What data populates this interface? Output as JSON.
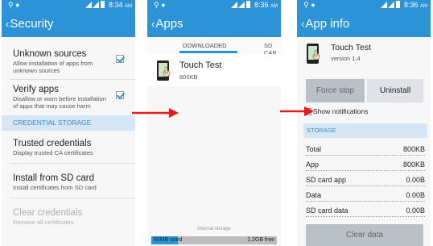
{
  "colors": {
    "accent": "#2d93d7",
    "header_bg": "#d6e6f4",
    "arrow": "#e8191c"
  },
  "status_bars": [
    {
      "time": "8:34",
      "ampm": "AM"
    },
    {
      "time": "8:36",
      "ampm": "AM"
    },
    {
      "time": "8:36",
      "ampm": "AM"
    }
  ],
  "security": {
    "title": "Security",
    "items": [
      {
        "title": "Unknown sources",
        "subtitle": "Allow installation of apps from unknown sources",
        "checked": true
      },
      {
        "title": "Verify apps",
        "subtitle": "Disallow or warn before installation of apps that may cause harm",
        "checked": true
      }
    ],
    "section_header": "CREDENTIAL STORAGE",
    "cred_items": [
      {
        "title": "Trusted credentials",
        "subtitle": "Display trusted CA certificates"
      },
      {
        "title": "Install from SD card",
        "subtitle": "Install certificates from SD card"
      },
      {
        "title": "Clear credentials",
        "subtitle": "Remove all certificates"
      }
    ]
  },
  "apps": {
    "title": "Apps",
    "tabs": [
      "DOWNLOADED",
      "SD CAR"
    ],
    "list": [
      {
        "name": "Touch Test",
        "size": "800KB"
      }
    ],
    "storage_label": "Internal storage",
    "used": "60MB used",
    "free": "1.2GB free"
  },
  "app_info": {
    "title": "App info",
    "app_name": "Touch Test",
    "version": "version 1.4",
    "force_stop": "Force stop",
    "uninstall": "Uninstall",
    "show_notifications": "Show notifications",
    "storage_header": "STORAGE",
    "rows": [
      {
        "label": "Total",
        "value": "800KB"
      },
      {
        "label": "App",
        "value": "800KB"
      },
      {
        "label": "SD card app",
        "value": "0.00B"
      },
      {
        "label": "Data",
        "value": "0.00B"
      },
      {
        "label": "SD card data",
        "value": "0.00B"
      }
    ],
    "clear_data": "Clear data"
  }
}
